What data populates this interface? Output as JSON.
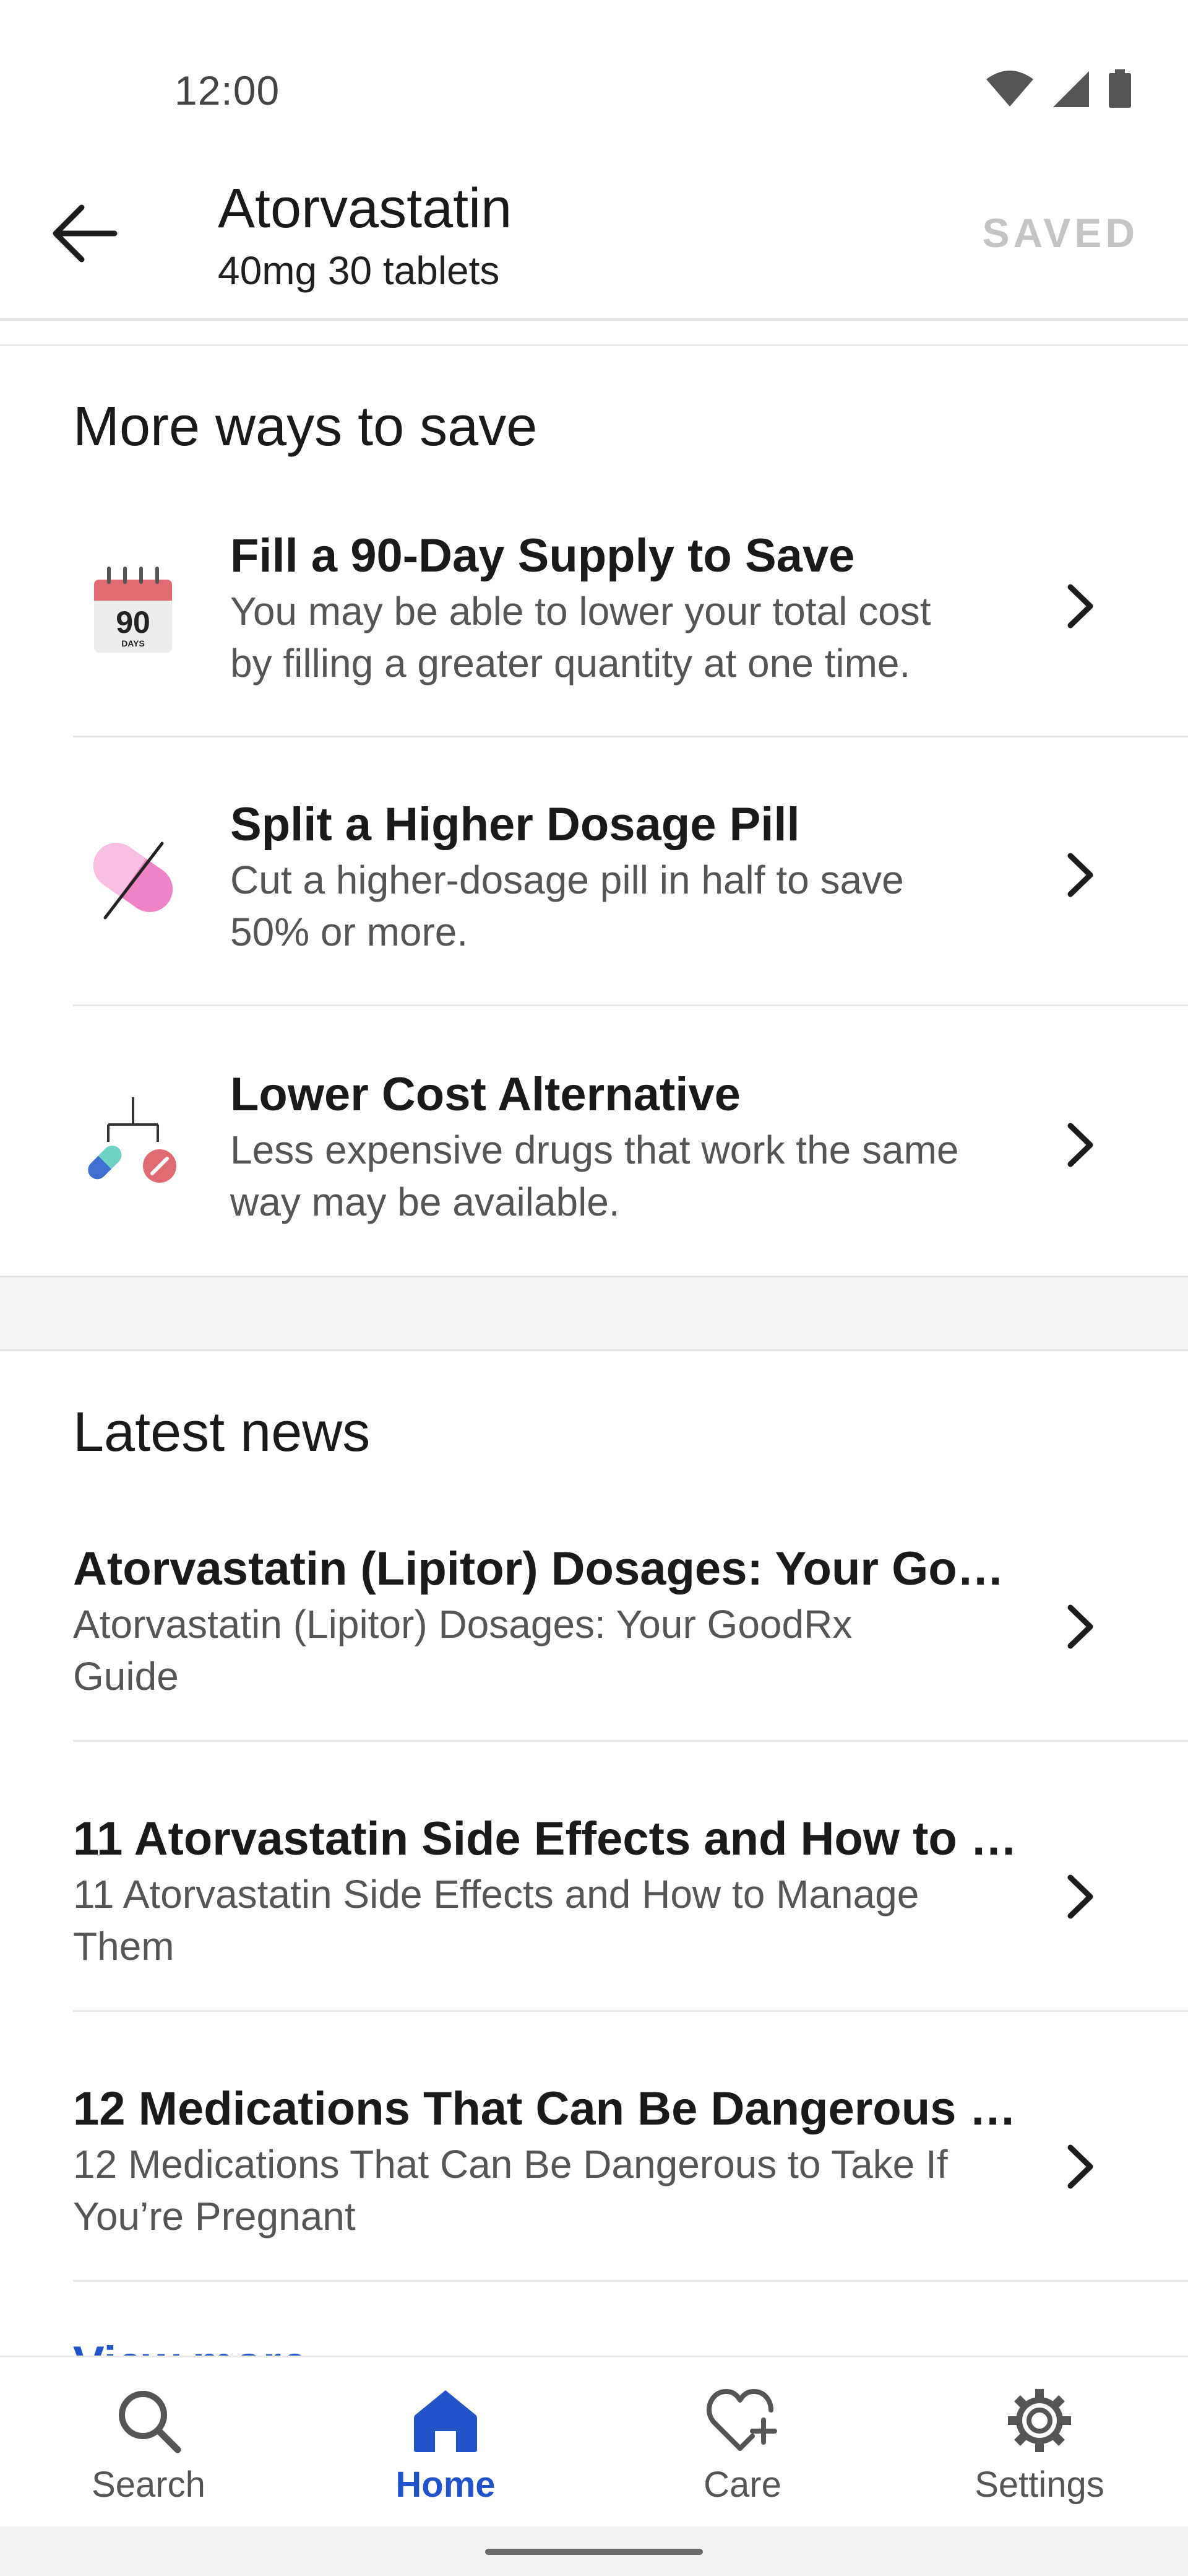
{
  "status_bar": {
    "time": "12:00"
  },
  "header": {
    "title": "Atorvastatin",
    "subtitle": "40mg 30 tablets",
    "saved_label": "SAVED"
  },
  "more_ways": {
    "heading": "More ways to save",
    "items": [
      {
        "title": "Fill a 90-Day Supply to Save",
        "desc_line1": "You may be able to lower your total cost",
        "desc_line2": "by filling a greater quantity at one time.",
        "icon": "calendar-90-days-icon",
        "calendar_number": "90",
        "calendar_caption": "DAYS"
      },
      {
        "title": "Split a Higher Dosage Pill",
        "desc_line1": "Cut a higher-dosage pill in half to save",
        "desc_line2": "50% or more.",
        "icon": "split-pill-icon"
      },
      {
        "title": "Lower Cost Alternative",
        "desc_line1": "Less expensive drugs that work the same",
        "desc_line2": "way may be available.",
        "icon": "alternative-drug-icon"
      }
    ]
  },
  "latest_news": {
    "heading": "Latest news",
    "items": [
      {
        "title": "Atorvastatin (Lipitor) Dosages: Your Good...",
        "desc_line1": "Atorvastatin (Lipitor) Dosages: Your GoodRx",
        "desc_line2": "Guide"
      },
      {
        "title": "11 Atorvastatin Side Effects and How to M...",
        "desc_line1": "11 Atorvastatin Side Effects and How to Manage",
        "desc_line2": "Them"
      },
      {
        "title": "12 Medications That Can Be Dangerous t...",
        "desc_line1": "12 Medications That Can Be Dangerous to Take If",
        "desc_line2": "You’re Pregnant"
      }
    ],
    "view_more_label": "View more"
  },
  "bottom_nav": {
    "items": [
      {
        "label": "Search",
        "icon": "search-icon",
        "active": false
      },
      {
        "label": "Home",
        "icon": "home-icon",
        "active": true
      },
      {
        "label": "Care",
        "icon": "heart-plus-icon",
        "active": false
      },
      {
        "label": "Settings",
        "icon": "gear-icon",
        "active": false
      }
    ]
  },
  "colors": {
    "accent": "#2253c9",
    "text_primary": "#1a1a1a",
    "text_secondary": "#555555",
    "saved_disabled": "#c4c4c4",
    "pill_pink": "#ee84c6",
    "calendar_red": "#e06a73",
    "capsule_teal": "#6ed3c4",
    "capsule_blue": "#3f6fd1"
  }
}
